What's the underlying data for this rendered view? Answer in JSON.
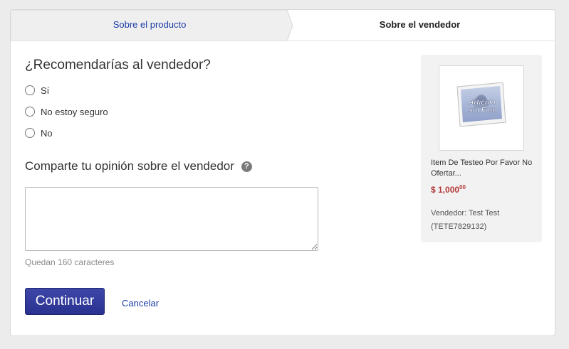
{
  "tabs": [
    {
      "label": "Sobre el producto",
      "active": false
    },
    {
      "label": "Sobre el vendedor",
      "active": true
    }
  ],
  "question": "¿Recomendarías al vendedor?",
  "options": [
    "Sí",
    "No estoy seguro",
    "No"
  ],
  "opinion": {
    "label": "Comparte tu opinión sobre el vendedor",
    "help_icon": "?"
  },
  "chars_left": "Quedan 160 caracteres",
  "buttons": {
    "continue": "Continuar",
    "cancel": "Cancelar"
  },
  "item": {
    "image_text_1": "Artículo",
    "image_text_2": "sin Foto",
    "title": "Item De Testeo Por Favor No Ofertar...",
    "price_main": "$ 1,000",
    "price_cents": "00",
    "seller_label": "Vendedor: Test Test",
    "seller_id": "(TETE7829132)"
  },
  "colors": {
    "link": "#1a3aa5",
    "button": "#2f3897",
    "price": "#b53a3a"
  }
}
